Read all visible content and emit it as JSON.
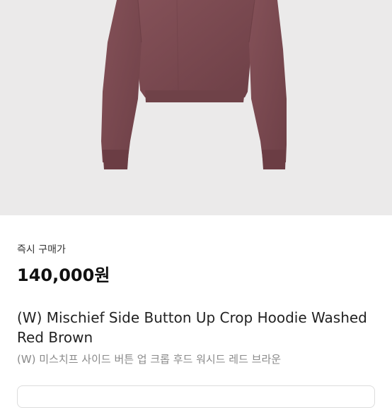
{
  "product": {
    "buy_label": "즉시 구매가",
    "price": "140,000원",
    "title": "(W) Mischief Side Button Up Crop Hoodie Washed Red Brown",
    "subtitle": "(W) 미스치프 사이드 버튼 업 크롭 후드 워시드 레드 브라운"
  },
  "colors": {
    "garment": "#7a4a50",
    "image_background": "#ebeaea",
    "price_text": "#111111",
    "subtitle_text": "#8a8a8a"
  }
}
